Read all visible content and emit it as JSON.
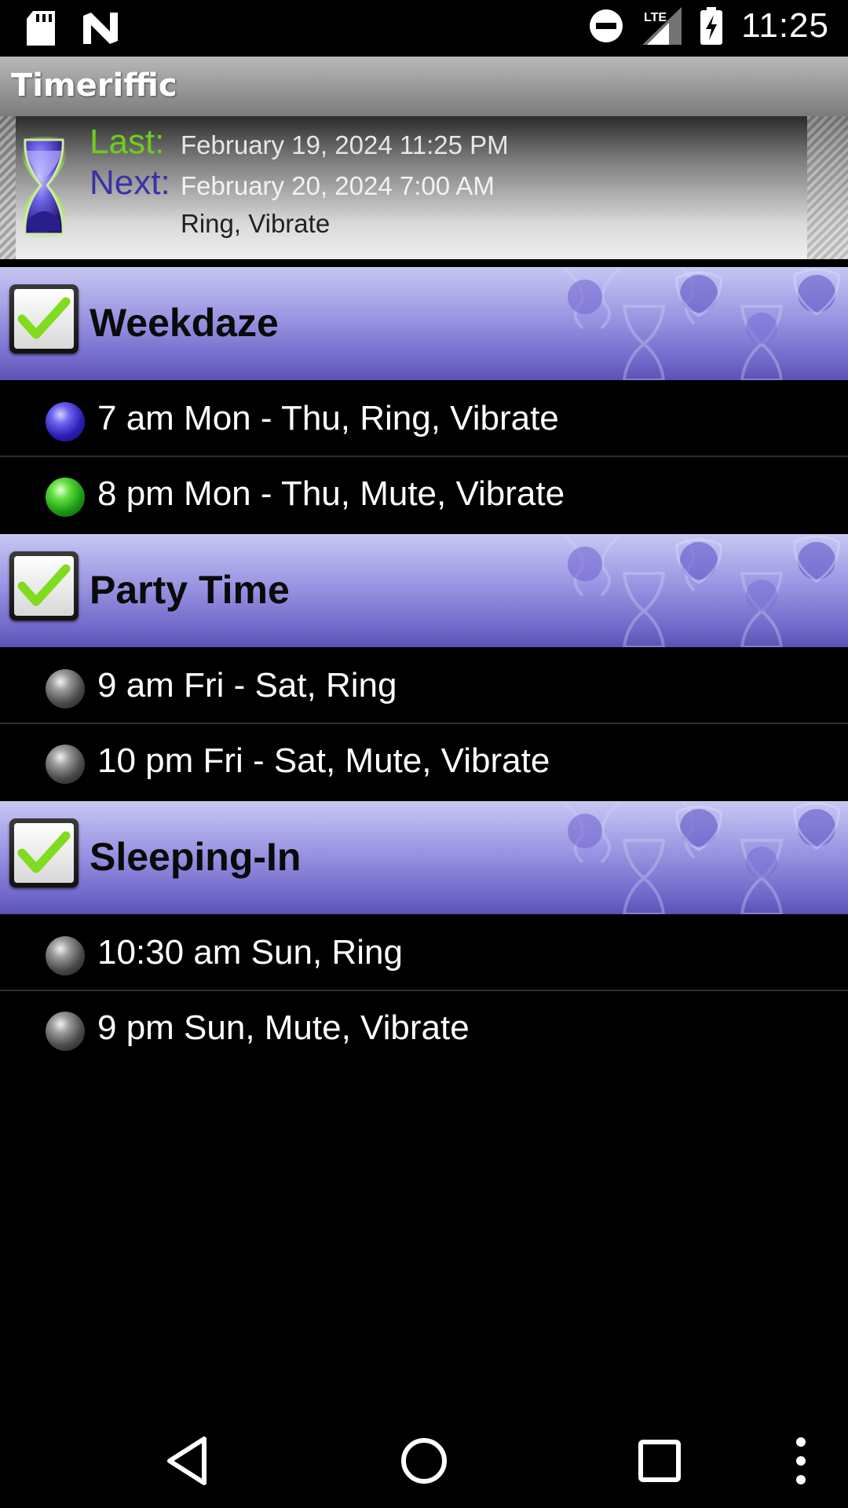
{
  "status_bar": {
    "time": "11:25",
    "network": "LTE",
    "icons": [
      "sd-card-icon",
      "n-logo-icon",
      "do-not-disturb-icon",
      "signal-icon",
      "battery-charging-icon"
    ]
  },
  "app": {
    "title": "Timeriffic"
  },
  "info": {
    "last_label": "Last:",
    "last_value": "February 19, 2024 11:25 PM",
    "next_label": "Next:",
    "next_value": "February 20, 2024 7:00 AM",
    "next_action": "Ring, Vibrate"
  },
  "groups": [
    {
      "title": "Weekdaze",
      "checked": true,
      "actions": [
        {
          "text": "7 am Mon - Thu, Ring, Vibrate",
          "bullet": "blue"
        },
        {
          "text": "8 pm Mon - Thu, Mute, Vibrate",
          "bullet": "green"
        }
      ]
    },
    {
      "title": "Party Time",
      "checked": true,
      "actions": [
        {
          "text": "9 am Fri - Sat, Ring",
          "bullet": "gray"
        },
        {
          "text": "10 pm Fri - Sat, Mute, Vibrate",
          "bullet": "gray"
        }
      ]
    },
    {
      "title": "Sleeping-In",
      "checked": true,
      "actions": [
        {
          "text": "10:30 am Sun, Ring",
          "bullet": "gray"
        },
        {
          "text": "9 pm Sun, Mute, Vibrate",
          "bullet": "gray"
        }
      ]
    }
  ],
  "colors": {
    "last_label": "#6fce1c",
    "next_label": "#3b31a8",
    "group_header": "#8f88dc",
    "check": "#7fdc1f"
  },
  "nav": {
    "icons": [
      "back-icon",
      "home-icon",
      "recents-icon",
      "overflow-menu-icon"
    ]
  }
}
